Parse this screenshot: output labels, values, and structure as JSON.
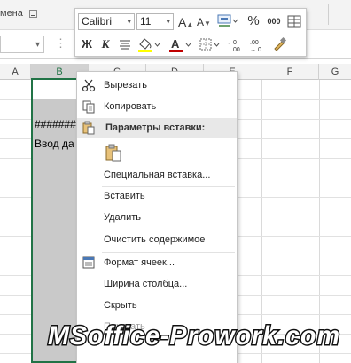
{
  "ribbon": {
    "group_label": "мена"
  },
  "columns": [
    "A",
    "B",
    "C",
    "D",
    "E",
    "F",
    "G"
  ],
  "cells": {
    "b2": "########",
    "b3": "Ввод да"
  },
  "mini_toolbar": {
    "font_name": "Calibri",
    "font_size": "11",
    "bold": "Ж",
    "italic": "К",
    "percent": "%",
    "thousands": "000",
    "grow_font": "A",
    "shrink_font": "A"
  },
  "context_menu": {
    "cut": "Вырезать",
    "copy": "Копировать",
    "paste_options_header": "Параметры вставки:",
    "paste_special": "Специальная вставка...",
    "insert": "Вставить",
    "delete": "Удалить",
    "clear_contents": "Очистить содержимое",
    "format_cells": "Формат ячеек...",
    "column_width": "Ширина столбца...",
    "hide": "Скрыть",
    "unhide": "Показать"
  },
  "watermark": {
    "text": "MSoffice-Prowork.com"
  },
  "colors": {
    "excel_green": "#217346",
    "highlight_yellow": "#ffff00",
    "font_red": "#c00000"
  }
}
